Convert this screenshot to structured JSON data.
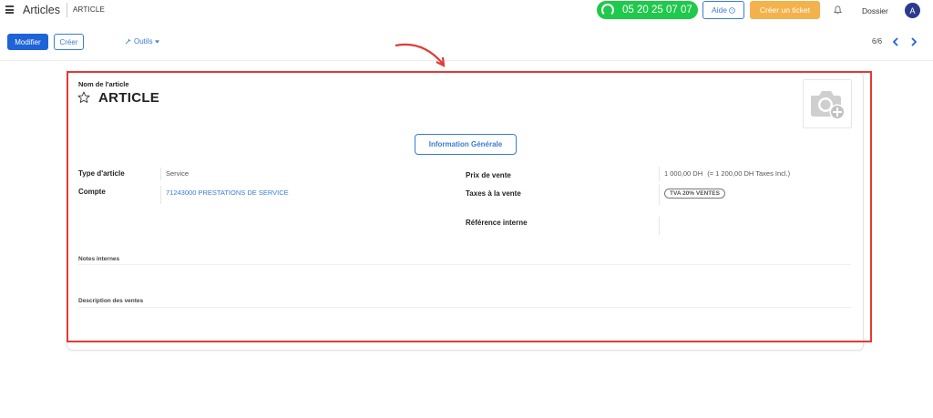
{
  "header": {
    "app_title": "Articles",
    "breadcrumb": "ARTICLE",
    "phone": "05 20 25 07 07",
    "help_label": "Aide",
    "ticket_label": "Créer un ticket",
    "dossier_label": "Dossier",
    "avatar_letter": "A"
  },
  "toolbar": {
    "edit_label": "Modifier",
    "create_label": "Créer",
    "tools_label": "Outils",
    "pager": "6/6"
  },
  "form": {
    "name_label": "Nom de l'article",
    "name_value": "ARTICLE",
    "tab_label": "Information Générale",
    "left_fields": [
      {
        "label": "Type d'article",
        "value": "Service"
      },
      {
        "label": "Compte",
        "value": "71243000 PRESTATIONS DE SERVICE"
      }
    ],
    "right_fields": [
      {
        "label": "Prix de vente",
        "value": "1 000,00 DH",
        "extra": "(= 1 200,00 DH Taxes Incl.)"
      },
      {
        "label": "Taxes à la vente",
        "value": "TVA 20% VENTES"
      },
      {
        "label": "Référence interne",
        "value": ""
      }
    ],
    "internal_notes_label": "Notes internes",
    "sales_description_label": "Description des ventes"
  },
  "colors": {
    "primary": "#1e64d8",
    "phone_bg": "#1fc94b",
    "ticket_bg": "#f4b24d",
    "highlight": "#e53935",
    "avatar_bg": "#2b3a8c"
  },
  "icons": [
    "menu-icon",
    "headset-icon",
    "question-icon",
    "bell-icon",
    "wrench-icon",
    "star-icon",
    "camera-add-icon",
    "chevron-left-icon",
    "chevron-right-icon",
    "arrow-annotation-icon"
  ]
}
